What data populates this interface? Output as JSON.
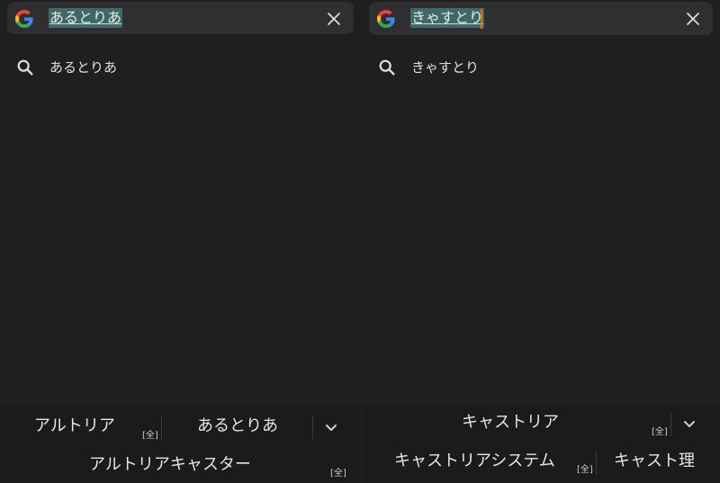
{
  "left": {
    "search": {
      "query": "あるとりあ"
    },
    "suggestions": [
      {
        "text": "あるとりあ"
      }
    ],
    "ime": {
      "row1": [
        {
          "label": "アルトリア",
          "tag": "[全]"
        },
        {
          "label": "あるとりあ"
        }
      ],
      "row2": [
        {
          "label": "アルトリアキャスター",
          "tag": "[全]"
        }
      ]
    }
  },
  "right": {
    "search": {
      "query": "きゃすとり"
    },
    "suggestions": [
      {
        "text": "きゃすとり"
      }
    ],
    "ime": {
      "row1": [
        {
          "label": "キャストリア",
          "tag": "[全]"
        }
      ],
      "row2": [
        {
          "label": "キャストリアシステム",
          "tag": "[全]"
        },
        {
          "label": "キャスト理"
        }
      ]
    }
  },
  "icons": {
    "logo": "google-g-icon",
    "clear": "close-icon",
    "suggestion": "search-icon",
    "expand": "chevron-down-icon"
  },
  "colors": {
    "background": "#1f1f1f",
    "search_bar": "#2f2f31",
    "selection": "#3e6a66",
    "caret": "#e8710a",
    "text": "#e8eaed"
  }
}
